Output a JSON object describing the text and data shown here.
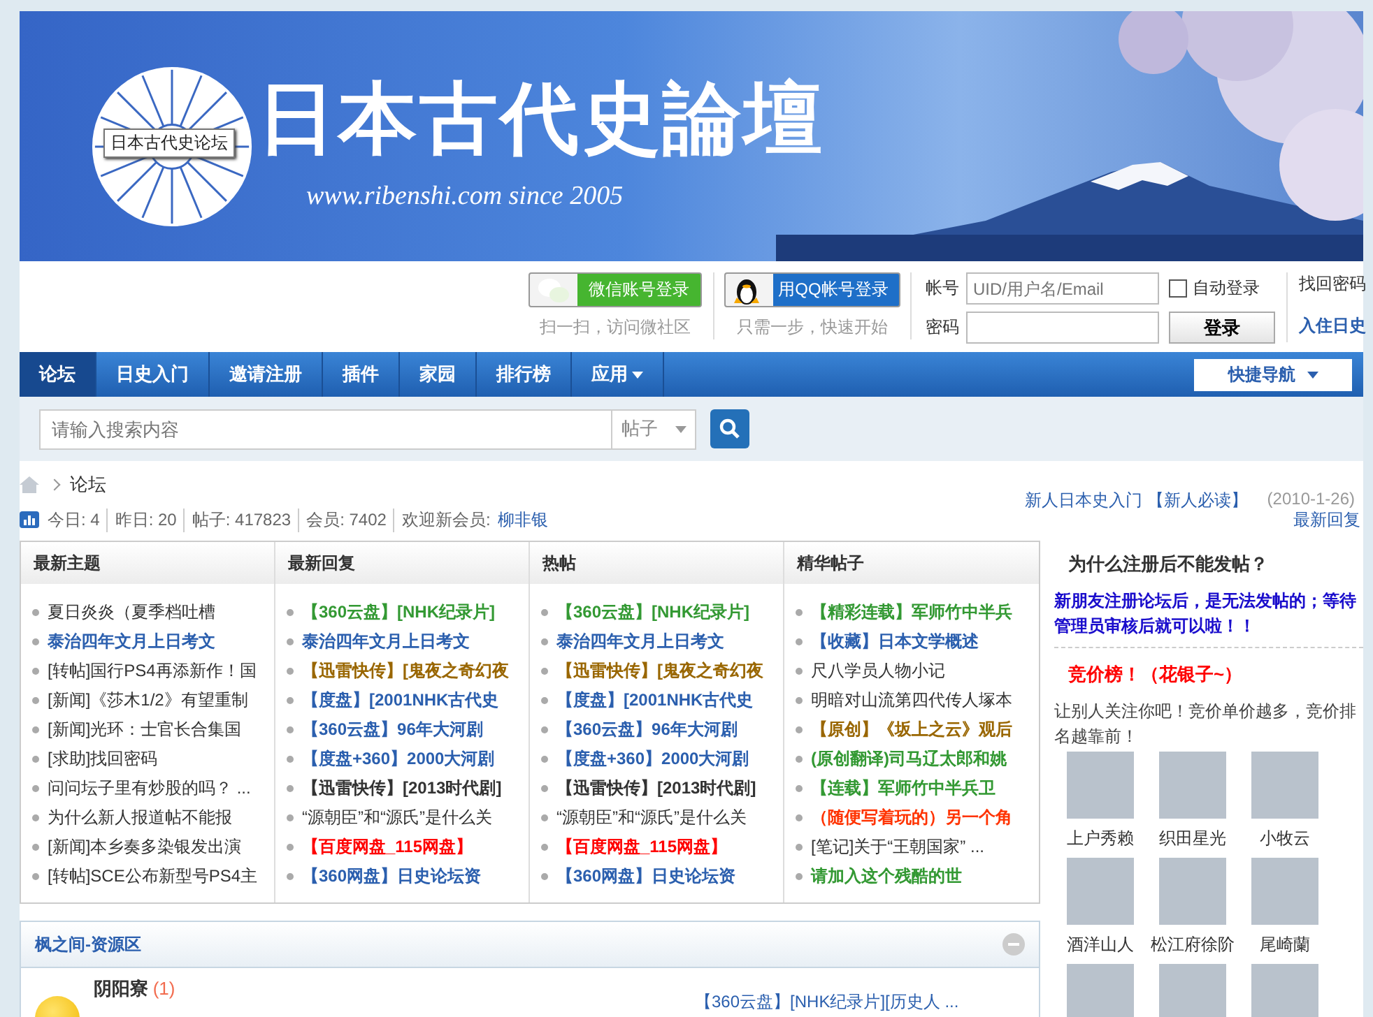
{
  "banner": {
    "logo_title": "日本古代史論壇",
    "tag": "日本古代史论坛",
    "url_line": "www.ribenshi.com since 2005"
  },
  "social_login": [
    {
      "kind": "wechat",
      "label": "微信账号登录",
      "hint": "扫一扫，访问微社区"
    },
    {
      "kind": "qq",
      "label": "用QQ帐号登录",
      "hint": "只需一步，快速开始"
    }
  ],
  "login": {
    "username_label": "帐号",
    "username_placeholder": "UID/用户名/Email",
    "password_label": "密码",
    "auto_login": {
      "label": "自动登录",
      "checked": false
    },
    "submit": "登录",
    "links": [
      "找回密码",
      "入住日史"
    ]
  },
  "nav": {
    "items": [
      {
        "label": "论坛",
        "selected": true,
        "dropdown": false
      },
      {
        "label": "日史入门",
        "selected": false,
        "dropdown": false
      },
      {
        "label": "邀请注册",
        "selected": false,
        "dropdown": false
      },
      {
        "label": "插件",
        "selected": false,
        "dropdown": false
      },
      {
        "label": "家园",
        "selected": false,
        "dropdown": false
      },
      {
        "label": "排行榜",
        "selected": false,
        "dropdown": false
      },
      {
        "label": "应用",
        "selected": false,
        "dropdown": true
      }
    ],
    "quick_nav": "快捷导航"
  },
  "search": {
    "placeholder": "请输入搜索内容",
    "scope": "帖子"
  },
  "breadcrumb": [
    "论坛"
  ],
  "announcement": {
    "title": "新人日本史入门",
    "tag": "【新人必读】",
    "date": "(2010-1-26)"
  },
  "stats": [
    {
      "label": "今日:",
      "value": "4"
    },
    {
      "label": "昨日:",
      "value": "20"
    },
    {
      "label": "帖子:",
      "value": "417823"
    },
    {
      "label": "会员:",
      "value": "7402"
    }
  ],
  "newest_member_label": "欢迎新会员:",
  "newest_member": "柳非银",
  "latest_reply_link": "最新回复",
  "sections": [
    {
      "title": "最新主题",
      "posts": [
        {
          "text": "夏日炎炎（夏季档吐槽",
          "color": "#333333",
          "bold": false
        },
        {
          "text": "泰治四年文月上日考文",
          "color": "#2b5fae",
          "bold": true
        },
        {
          "text": "[转帖]国行PS4再添新作！国",
          "color": "#333333",
          "bold": false
        },
        {
          "text": "[新闻]《莎木1/2》有望重制",
          "color": "#333333",
          "bold": false
        },
        {
          "text": "[新闻]光环：士官长合集国",
          "color": "#333333",
          "bold": false
        },
        {
          "text": "[求助]找回密码",
          "color": "#333333",
          "bold": false
        },
        {
          "text": "问问坛子里有炒股的吗？ ...",
          "color": "#333333",
          "bold": false
        },
        {
          "text": "为什么新人报道帖不能报",
          "color": "#333333",
          "bold": false
        },
        {
          "text": "[新闻]本乡奏多染银发出演",
          "color": "#333333",
          "bold": false
        },
        {
          "text": "[转帖]SCE公布新型号PS4主",
          "color": "#333333",
          "bold": false
        }
      ]
    },
    {
      "title": "最新回复",
      "posts": [
        {
          "text": "【360云盘】[NHK纪录片]",
          "color": "#339933",
          "bold": true
        },
        {
          "text": "泰治四年文月上日考文",
          "color": "#2b5fae",
          "bold": true
        },
        {
          "text": "【迅雷快传】[鬼夜之奇幻夜",
          "color": "#996600",
          "bold": true
        },
        {
          "text": "【度盘】[2001NHK古代史",
          "color": "#2b5fae",
          "bold": true
        },
        {
          "text": "【360云盘】96年大河剧",
          "color": "#2b5fae",
          "bold": true
        },
        {
          "text": "【度盘+360】2000大河剧",
          "color": "#2b5fae",
          "bold": true
        },
        {
          "text": "【迅雷快传】[2013时代剧]",
          "color": "#333333",
          "bold": true
        },
        {
          "text": "“源朝臣”和“源氏”是什么关",
          "color": "#333333",
          "bold": false
        },
        {
          "text": "【百度网盘_115网盘】",
          "color": "#ff0000",
          "bold": true
        },
        {
          "text": "【360网盘】日史论坛资",
          "color": "#2b5fae",
          "bold": true
        }
      ]
    },
    {
      "title": "热帖",
      "posts": [
        {
          "text": "【360云盘】[NHK纪录片]",
          "color": "#339933",
          "bold": true
        },
        {
          "text": "泰治四年文月上日考文",
          "color": "#2b5fae",
          "bold": true
        },
        {
          "text": "【迅雷快传】[鬼夜之奇幻夜",
          "color": "#996600",
          "bold": true
        },
        {
          "text": "【度盘】[2001NHK古代史",
          "color": "#2b5fae",
          "bold": true
        },
        {
          "text": "【360云盘】96年大河剧",
          "color": "#2b5fae",
          "bold": true
        },
        {
          "text": "【度盘+360】2000大河剧",
          "color": "#2b5fae",
          "bold": true
        },
        {
          "text": "【迅雷快传】[2013时代剧]",
          "color": "#333333",
          "bold": true
        },
        {
          "text": "“源朝臣”和“源氏”是什么关",
          "color": "#333333",
          "bold": false
        },
        {
          "text": "【百度网盘_115网盘】",
          "color": "#ff0000",
          "bold": true
        },
        {
          "text": "【360网盘】日史论坛资",
          "color": "#2b5fae",
          "bold": true
        }
      ]
    },
    {
      "title": "精华帖子",
      "posts": [
        {
          "text": "【精彩连载】军师竹中半兵",
          "color": "#339933",
          "bold": true
        },
        {
          "text": "【收藏】日本文学概述",
          "color": "#2b5fae",
          "bold": true
        },
        {
          "text": "尺八学员人物小记",
          "color": "#333333",
          "bold": false
        },
        {
          "text": "明暗对山流第四代传人塚本",
          "color": "#333333",
          "bold": false
        },
        {
          "text": "【原创】《坂上之云》观后",
          "color": "#996600",
          "bold": true
        },
        {
          "text": "(原创翻译)司马辽太郎和姚",
          "color": "#339933",
          "bold": true
        },
        {
          "text": "【连载】军师竹中半兵卫",
          "color": "#339933",
          "bold": true
        },
        {
          "text": "（随便写着玩的）另一个角",
          "color": "#ff3300",
          "bold": true
        },
        {
          "text": "[笔记]关于“王朝国家” ...",
          "color": "#333333",
          "bold": false
        },
        {
          "text": "请加入这个残酷的世",
          "color": "#339933",
          "bold": true
        }
      ]
    }
  ],
  "sidebar": {
    "notice_title": "为什么注册后不能发帖？",
    "notice_text": "新朋友注册论坛后，是无法发帖的；等待管理员审核后就可以啦！！",
    "bid_title": "竞价榜！（花银子~）",
    "bid_text": "让别人关注你吧！竞价单价越多，竞价排名越靠前！",
    "members": [
      {
        "name": "上户秀赖"
      },
      {
        "name": "织田星光"
      },
      {
        "name": "小牧云"
      },
      {
        "name": "酒洋山人"
      },
      {
        "name": "松江府徐阶"
      },
      {
        "name": "尾崎蘭"
      }
    ]
  },
  "category": {
    "title": "枫之间-资源区",
    "forums": [
      {
        "name": "阴阳寮",
        "new_count": "(1)",
        "last_post": "【360云盘】[NHK纪录片][历史人 ..."
      }
    ]
  }
}
